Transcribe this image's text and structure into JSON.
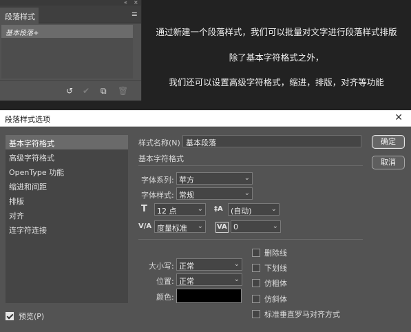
{
  "panel": {
    "strip_controls": [
      "«",
      "×"
    ],
    "tab_label": "段落样式",
    "menu_icon": "hamburger-menu-icon",
    "styles": [
      "基本段落+"
    ],
    "footer_icons": [
      {
        "name": "clear-override-icon",
        "glyph": "↺",
        "enabled": true
      },
      {
        "name": "redefine-style-icon",
        "glyph": "✔",
        "enabled": false
      },
      {
        "name": "new-style-icon",
        "glyph": "⧉",
        "enabled": true
      },
      {
        "name": "delete-icon",
        "glyph": "🗑",
        "enabled": false
      }
    ]
  },
  "captions": [
    "通过新建一个段落样式，我们可以批量对文字进行段落样式排版",
    "除了基本字符格式之外，",
    "我们还可以设置高级字符格式，缩进，排版，对齐等功能"
  ],
  "dialog": {
    "title": "段落样式选项",
    "close_glyph": "✕",
    "categories": [
      "基本字符格式",
      "高级字符格式",
      "OpenType 功能",
      "缩进和间距",
      "排版",
      "对齐",
      "连字符连接"
    ],
    "selected_category": "基本字符格式",
    "preview": {
      "label": "预览(P)",
      "checked": true
    },
    "buttons": {
      "ok": "确定",
      "cancel": "取消"
    },
    "style_name_label": "样式名称(N)",
    "style_name_value": "基本段落",
    "section_title": "基本字符格式",
    "font_family_label": "字体系列:",
    "font_family_value": "苹方",
    "font_style_label": "字体样式:",
    "font_style_value": "常规",
    "font_size_value": "12 点",
    "leading_value": "(自动)",
    "kerning_value": "度量标准",
    "tracking_value": "0",
    "case_label": "大小写:",
    "case_value": "正常",
    "position_label": "位置:",
    "position_value": "正常",
    "color_label": "颜色:",
    "color_value": "#000000",
    "checkboxes": [
      "删除线",
      "下划线",
      "仿粗体",
      "仿斜体",
      "标准垂直罗马对齐方式"
    ],
    "dropdown_glyph": "⌄",
    "field_icons": {
      "font_size": "T",
      "leading": "‡A",
      "kerning": "V/A",
      "tracking": "VA"
    }
  }
}
